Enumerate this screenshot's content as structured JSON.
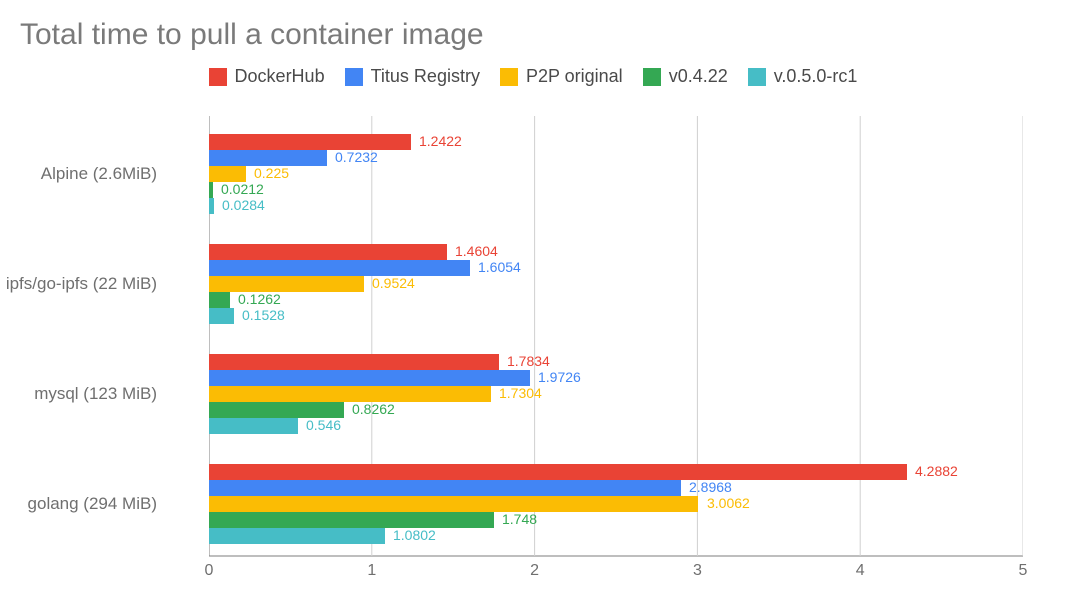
{
  "chart_data": {
    "type": "bar",
    "orientation": "horizontal",
    "title": "Total time to pull a container image",
    "xlabel": "",
    "ylabel": "",
    "xlim": [
      0,
      5
    ],
    "xticks": [
      0,
      1,
      2,
      3,
      4,
      5
    ],
    "categories": [
      "Alpine (2.6MiB)",
      "ipfs/go-ipfs (22 MiB)",
      "mysql (123 MiB)",
      "golang (294 MiB)"
    ],
    "series": [
      {
        "name": "DockerHub",
        "color": "#e94335",
        "values": [
          1.2422,
          1.4604,
          1.7834,
          4.2882
        ]
      },
      {
        "name": "Titus Registry",
        "color": "#4285f4",
        "values": [
          0.7232,
          1.6054,
          1.9726,
          2.8968
        ]
      },
      {
        "name": "P2P original",
        "color": "#fbbc04",
        "values": [
          0.225,
          0.9524,
          1.7304,
          3.0062
        ]
      },
      {
        "name": "v0.4.22",
        "color": "#34a853",
        "values": [
          0.0212,
          0.1262,
          0.8262,
          1.748
        ]
      },
      {
        "name": "v.0.5.0-rc1",
        "color": "#46bdc6",
        "values": [
          0.0284,
          0.1528,
          0.546,
          1.0802
        ]
      }
    ]
  }
}
